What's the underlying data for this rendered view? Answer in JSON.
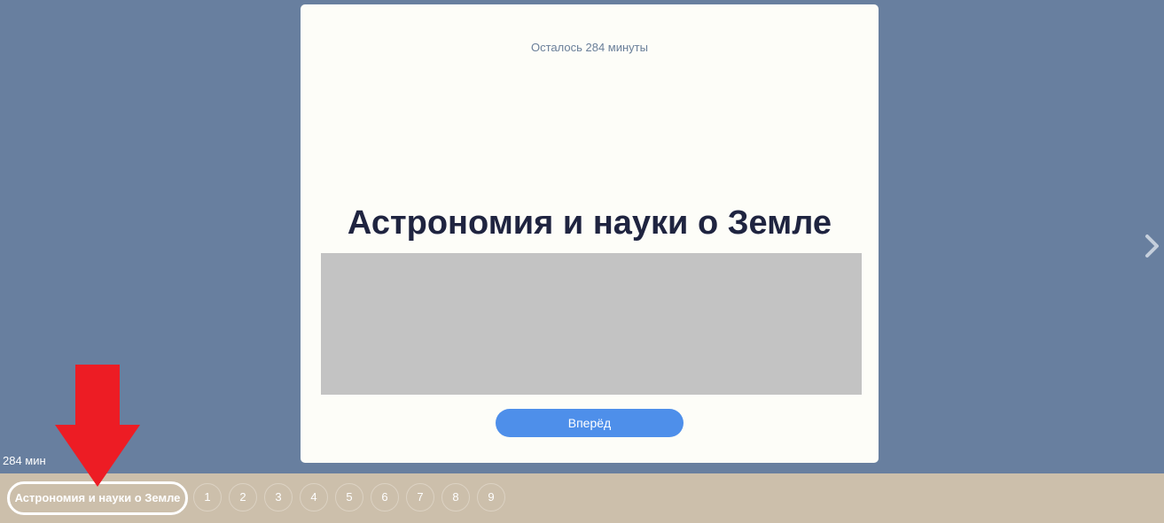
{
  "card": {
    "time_left": "Осталось 284 минуты",
    "title": "Астрономия и науки о Земле",
    "next_label": "Вперёд"
  },
  "sidebar_time": "284 мин",
  "bottom_bar": {
    "section_label": "Астрономия и науки о Земле",
    "pages": [
      "1",
      "2",
      "3",
      "4",
      "5",
      "6",
      "7",
      "8",
      "9"
    ]
  },
  "colors": {
    "background": "#687f9f",
    "card": "#fdfdf8",
    "button": "#4e8fea",
    "bottom_bar": "#ccbfab",
    "annotation_arrow": "#ed1c24"
  },
  "icons": {
    "next": "chevron-right-icon",
    "annotation": "arrow-down-icon"
  }
}
